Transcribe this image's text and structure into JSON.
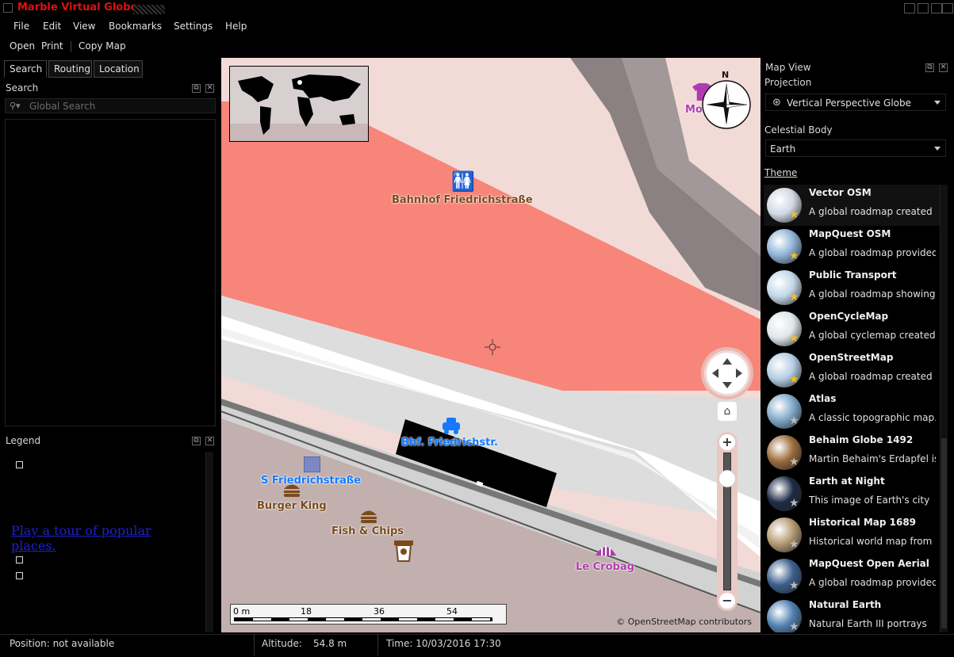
{
  "window": {
    "title": "Marble Virtual Globe"
  },
  "menu": [
    "File",
    "Edit",
    "View",
    "Bookmarks",
    "Settings",
    "Help"
  ],
  "toolbar": {
    "open": "Open",
    "print": "Print",
    "copy_map": "Copy Map"
  },
  "left_tabs": [
    "Search",
    "Routing",
    "Location"
  ],
  "search": {
    "title": "Search",
    "placeholder": "Global Search"
  },
  "legend": {
    "title": "Legend",
    "tour_link": "Play a tour of popular places."
  },
  "map": {
    "labels": {
      "bahnhof": "Bahnhof Friedrichstraße",
      "bhf": "Bhf. Friedrichstr.",
      "s_friedrich": "S Friedrichstraße",
      "burger": "Burger King",
      "fish": "Fish & Chips",
      "crobag": "Le Crobag",
      "monki": "Monki"
    },
    "compass_n": "N",
    "scale": {
      "l0": "0 m",
      "l1": "18",
      "l2": "36",
      "l3": "54"
    },
    "attribution": "© OpenStreetMap contributors"
  },
  "mapview": {
    "title": "Map View",
    "projection_label": "Projection",
    "projection_value": "Vertical Perspective Globe",
    "celestial_label": "Celestial Body",
    "celestial_value": "Earth",
    "theme_label": "Theme",
    "themes": [
      {
        "name": "Vector OSM",
        "desc": "A global roadmap created",
        "star": "gold",
        "color": "#cfd8e4"
      },
      {
        "name": "MapQuest OSM",
        "desc": "A global roadmap provided",
        "star": "gold",
        "color": "#8fb3d6"
      },
      {
        "name": "Public Transport",
        "desc": "A global roadmap showing",
        "star": "gold",
        "color": "#c2d6e8"
      },
      {
        "name": "OpenCycleMap",
        "desc": "A global cyclemap created",
        "star": "gold",
        "color": "#dfe6ea"
      },
      {
        "name": "OpenStreetMap",
        "desc": "A global roadmap created",
        "star": "gold",
        "color": "#b3cde3"
      },
      {
        "name": "Atlas",
        "desc": "A classic topographic map.",
        "star": "gray",
        "color": "#7fa8c8"
      },
      {
        "name": "Behaim Globe 1492",
        "desc": "Martin Behaim's Erdapfel is",
        "star": "gray",
        "color": "#9b6a3b"
      },
      {
        "name": "Earth at Night",
        "desc": "This image of Earth's city",
        "star": "gray",
        "color": "#1c2a44"
      },
      {
        "name": "Historical Map 1689",
        "desc": "Historical world map from",
        "star": "gray",
        "color": "#b49a72"
      },
      {
        "name": "MapQuest Open Aerial",
        "desc": "A global roadmap provided",
        "star": "gray",
        "color": "#3a5f8a"
      },
      {
        "name": "Natural Earth",
        "desc": "Natural Earth III portrays",
        "star": "gray",
        "color": "#4f7fae"
      }
    ]
  },
  "status": {
    "position": "Position: not available",
    "altitude_label": "Altitude:",
    "altitude_value": "54.8 m",
    "time": "Time: 10/03/2016 17:30"
  }
}
